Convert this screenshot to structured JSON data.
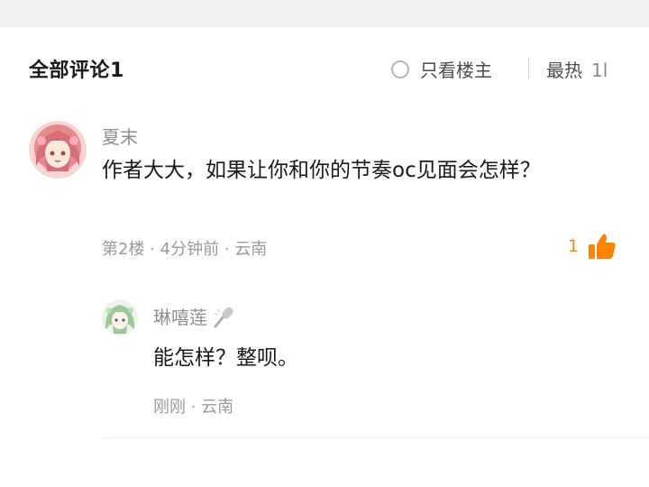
{
  "header": {
    "title": "全部评论1",
    "filter_label": "只看楼主",
    "sort_label": "最热",
    "sort_extra": "1l"
  },
  "comment": {
    "author": "夏末",
    "text": "作者大大，如果让你和你的节奏oc见面会怎样？",
    "meta": "第2楼 · 4分钟前 · 云南",
    "likes": "1",
    "avatar": "avatar-pink-hair-girl",
    "like_icon": "thumbs-up-icon",
    "accent_color": "#ff8200"
  },
  "reply": {
    "author": "琳嘻莲",
    "author_badge": "microphone-icon",
    "text": "能怎样？整呗。",
    "meta": "刚刚 · 云南",
    "avatar": "avatar-green-hair-girl"
  }
}
